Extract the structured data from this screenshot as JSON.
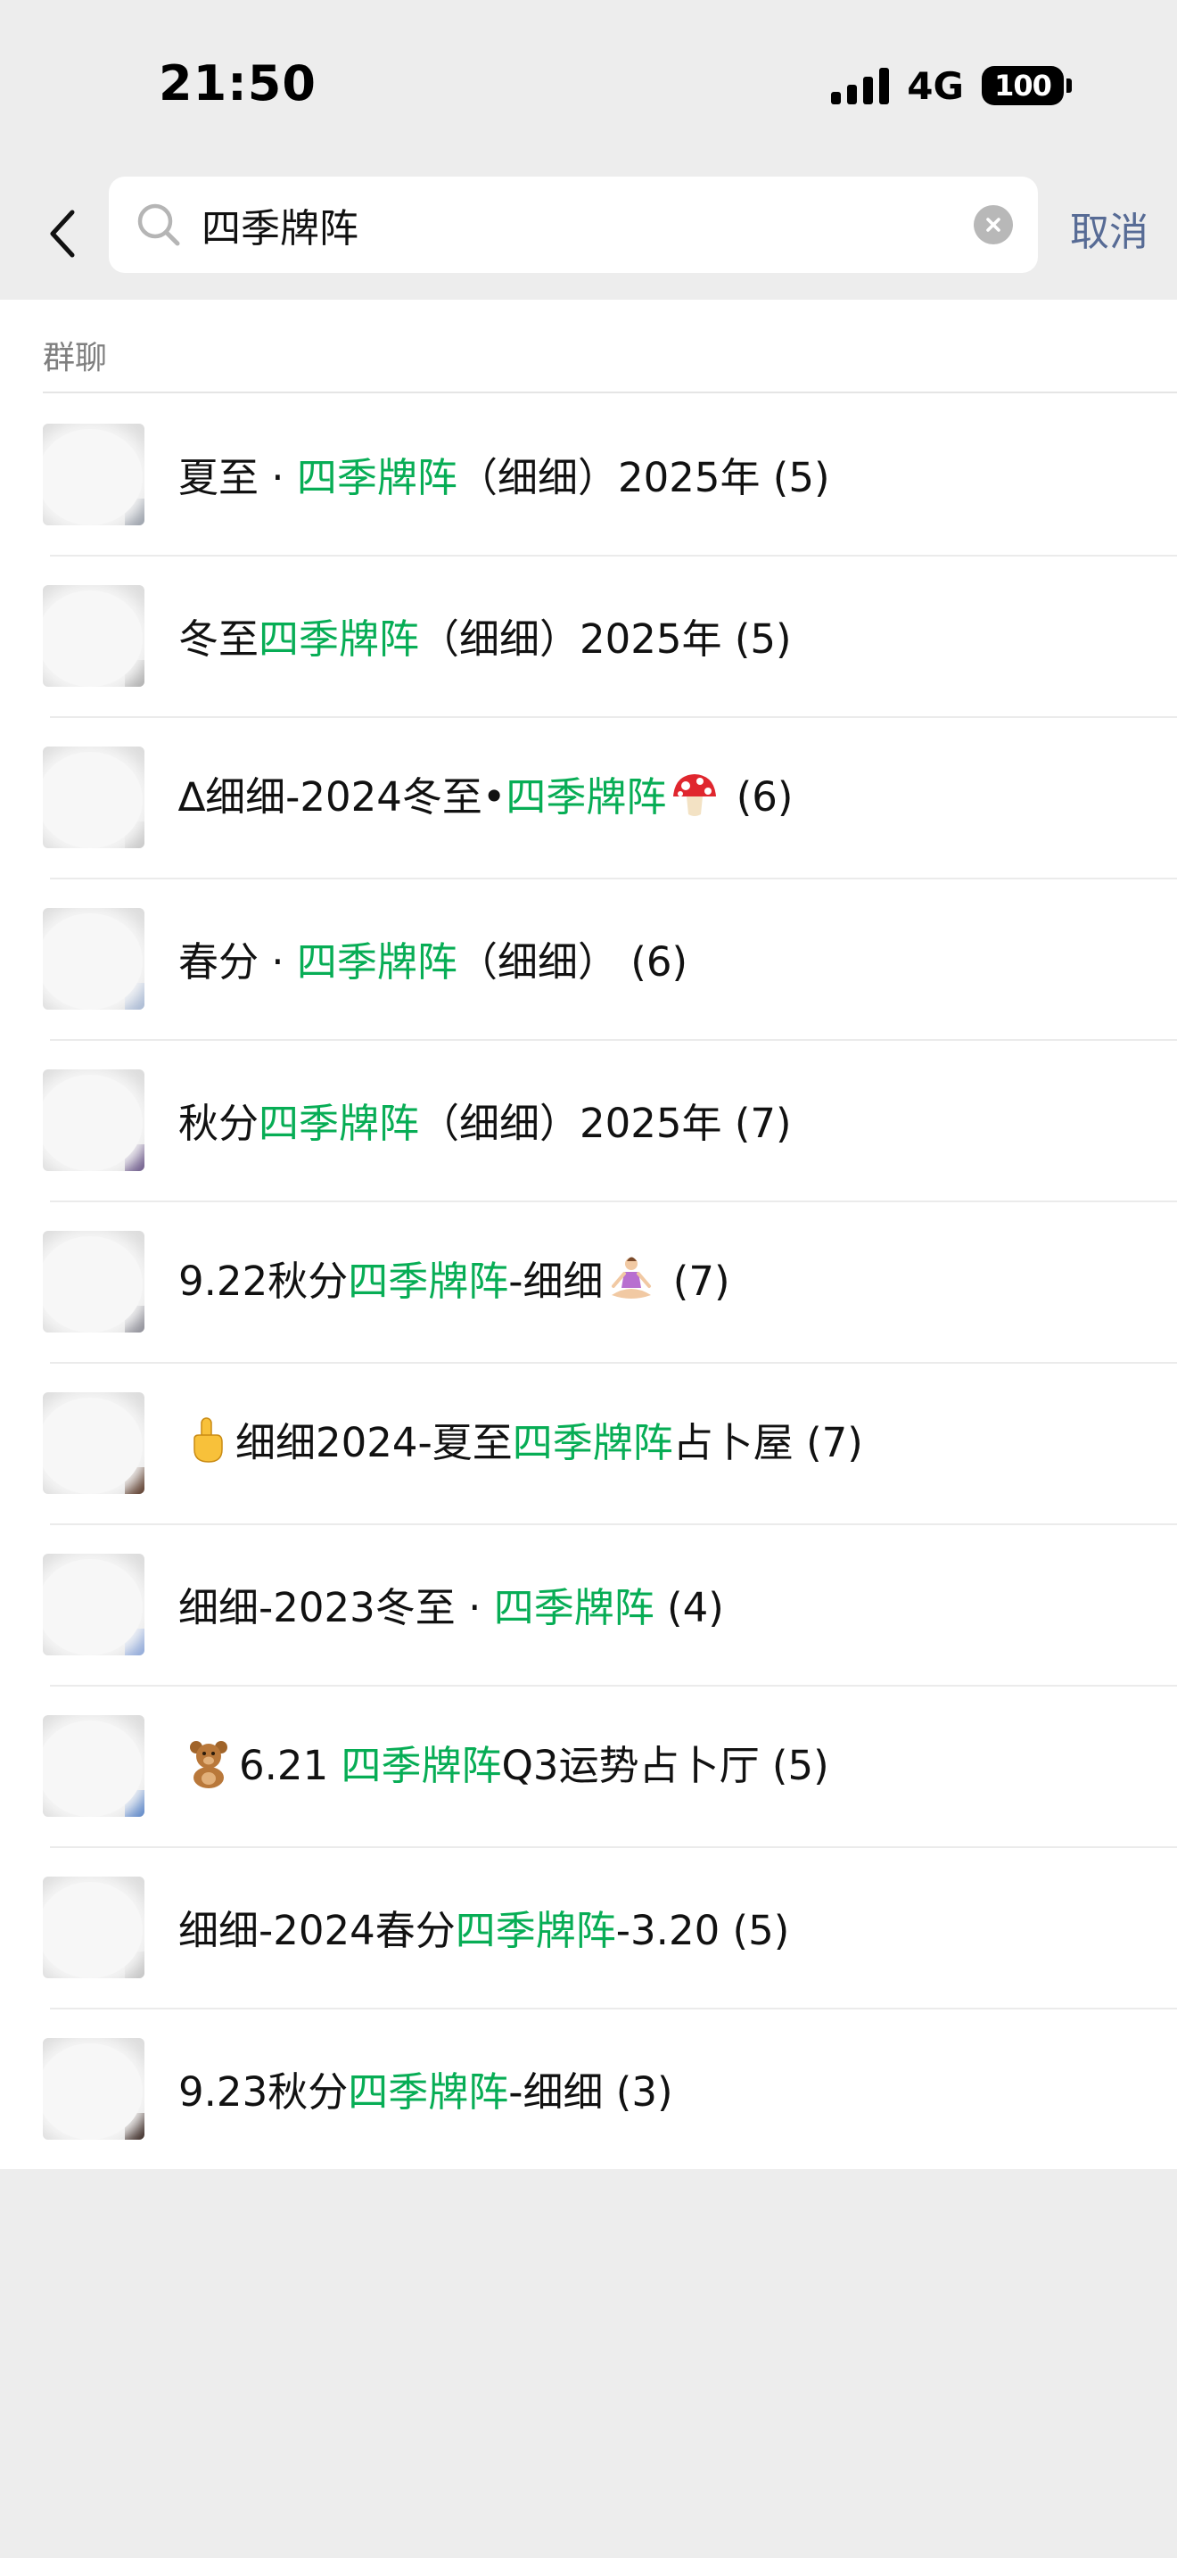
{
  "status_bar": {
    "time": "21:50",
    "network": "4G",
    "battery": "100"
  },
  "search": {
    "query": "四季牌阵",
    "cancel_label": "取消"
  },
  "colors": {
    "highlight": "#07ad55",
    "link_blue": "#576b95",
    "background": "#ededed"
  },
  "results": {
    "section_title": "群聊",
    "items": [
      {
        "prefix": "夏至 · ",
        "match": "四季牌阵",
        "suffix": "（细细）2025年",
        "count": "(5)"
      },
      {
        "prefix": "冬至",
        "match": "四季牌阵",
        "suffix": "（细细）2025年",
        "count": "(5)"
      },
      {
        "prefix": "∆细细-2024冬至•",
        "match": "四季牌阵",
        "suffix": "",
        "emoji": "mushroom-icon",
        "count": "(6)"
      },
      {
        "prefix": "春分 · ",
        "match": "四季牌阵",
        "suffix": "（细细）",
        "count": "(6)"
      },
      {
        "prefix": "秋分",
        "match": "四季牌阵",
        "suffix": "（细细）2025年",
        "count": "(7)"
      },
      {
        "prefix": "9.22秋分",
        "match": "四季牌阵",
        "suffix": "-细细",
        "emoji": "meditating-woman-icon",
        "count": "(7)"
      },
      {
        "prefix": "细细2024-夏至",
        "match": "四季牌阵",
        "suffix": "占卜屋",
        "lead_emoji": "pointing-up-icon",
        "count": "(7)"
      },
      {
        "prefix": "细细-2023冬至 · ",
        "match": "四季牌阵",
        "suffix": "",
        "count": "(4)"
      },
      {
        "prefix": "6.21 ",
        "match": "四季牌阵",
        "suffix": "Q3运势占卜厅",
        "lead_emoji": "teddy-bear-icon",
        "count": "(5)"
      },
      {
        "prefix": "细细-2024春分",
        "match": "四季牌阵",
        "suffix": "-3.20",
        "count": "(5)"
      },
      {
        "prefix": "9.23秋分",
        "match": "四季牌阵",
        "suffix": "-细细",
        "count": "(3)"
      }
    ]
  }
}
